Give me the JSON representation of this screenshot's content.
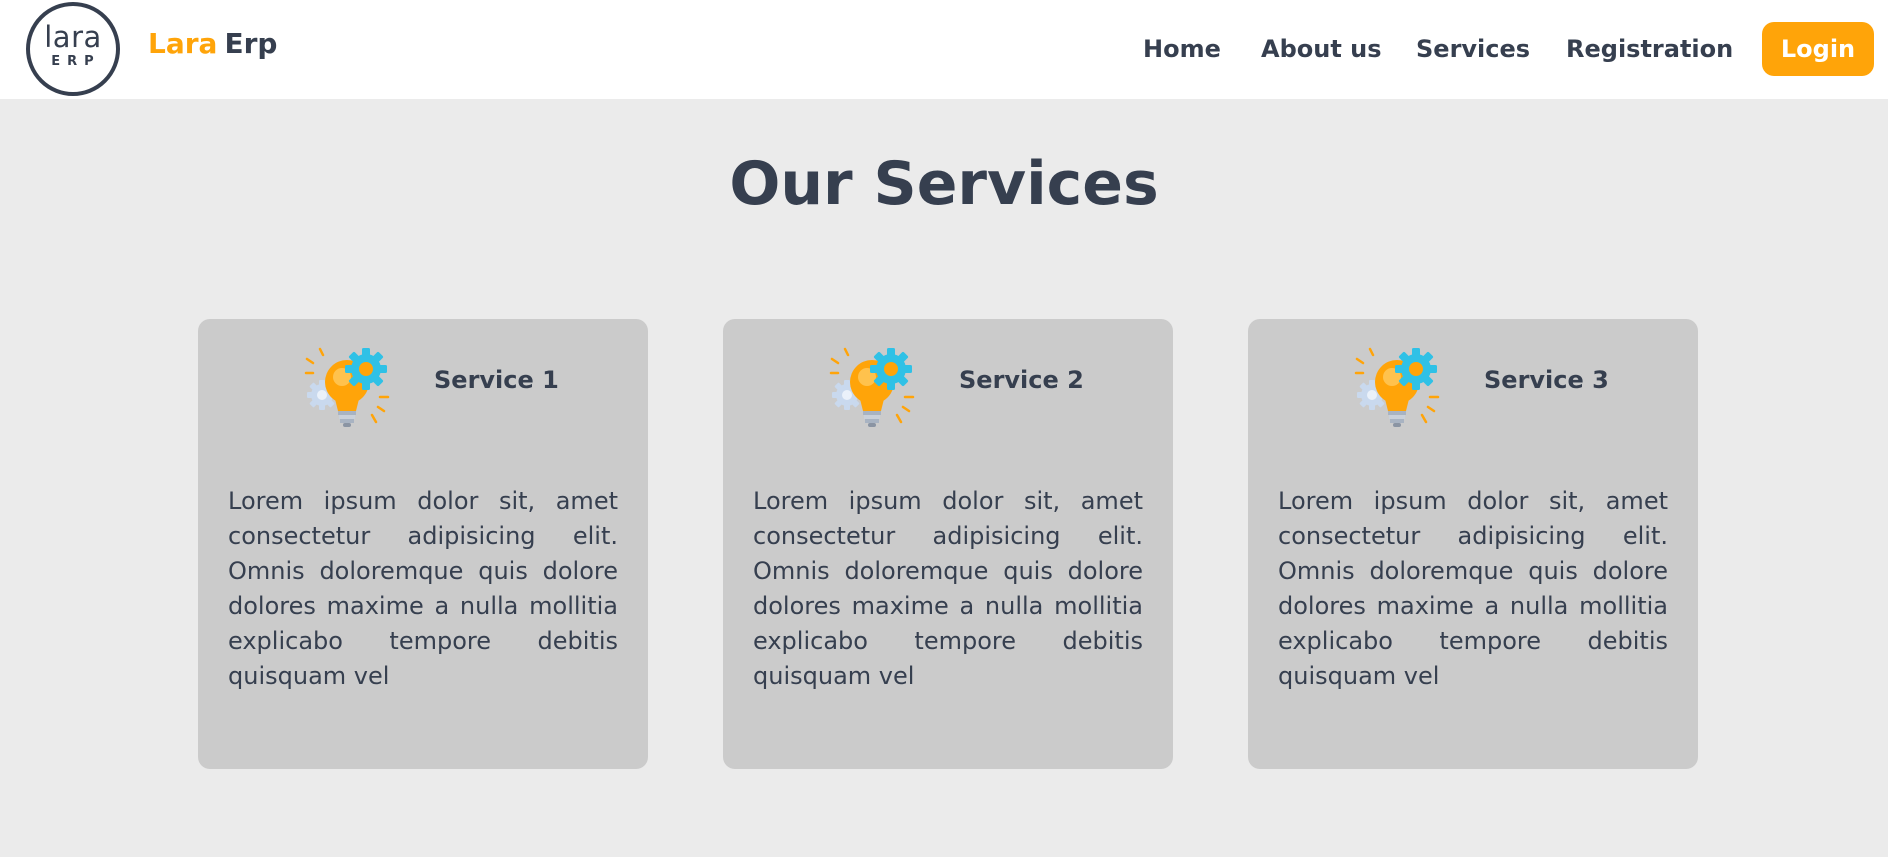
{
  "brand": {
    "logo_word": "lara",
    "logo_sub": "ERP",
    "name_part1": "Lara",
    "name_part2": "Erp"
  },
  "nav": {
    "home": "Home",
    "about": "About us",
    "services": "Services",
    "registration": "Registration",
    "login": "Login"
  },
  "colors": {
    "accent": "#ffa409",
    "text": "#363f4f",
    "page_bg": "#ebebeb",
    "card_bg": "#cbcbcb"
  },
  "section": {
    "title": "Our Services"
  },
  "services": [
    {
      "icon": "lightbulb-gear-icon",
      "title": "Service 1",
      "text": "Lorem ipsum dolor sit, amet consectetur adipisicing elit. Omnis doloremque quis dolore dolores maxime a nulla mollitia explicabo tempore debitis quisquam vel"
    },
    {
      "icon": "lightbulb-gear-icon",
      "title": "Service 2",
      "text": "Lorem ipsum dolor sit, amet consectetur adipisicing elit. Omnis doloremque quis dolore dolores maxime a nulla mollitia explicabo tempore debitis quisquam vel"
    },
    {
      "icon": "lightbulb-gear-icon",
      "title": "Service 3",
      "text": "Lorem ipsum dolor sit, amet consectetur adipisicing elit. Omnis doloremque quis dolore dolores maxime a nulla mollitia explicabo tempore debitis quisquam vel"
    }
  ]
}
